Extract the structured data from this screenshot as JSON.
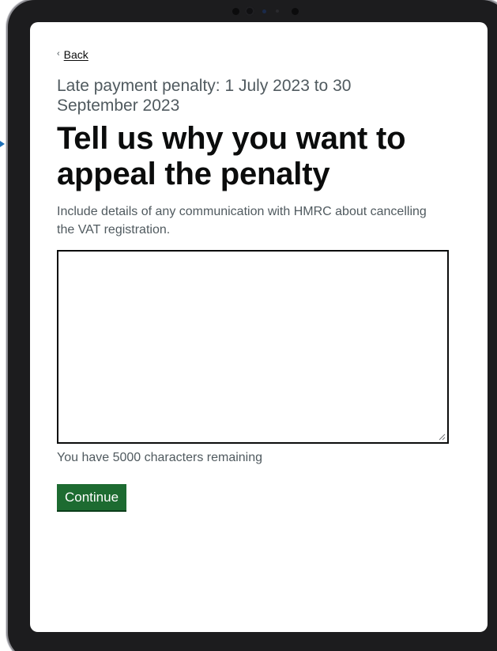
{
  "nav": {
    "back_label": "Back",
    "back_chevron": "‹"
  },
  "page": {
    "caption": "Late payment penalty: 1 July 2023 to 30 September 2023",
    "heading": "Tell us why you want to appeal the penalty",
    "hint": "Include details of any communication with HMRC about cancelling the VAT registration."
  },
  "form": {
    "reason_value": "",
    "characters_remaining": "You have 5000 characters remaining",
    "continue_label": "Continue"
  },
  "icons": {
    "back": "chevron-left-icon",
    "resize": "resize-grip-icon"
  },
  "colors": {
    "text": "#0b0c0c",
    "secondary_text": "#505a5f",
    "button": "#1d6b31",
    "button_shadow": "#0b3d1a",
    "link_marker": "#1d70b8"
  }
}
